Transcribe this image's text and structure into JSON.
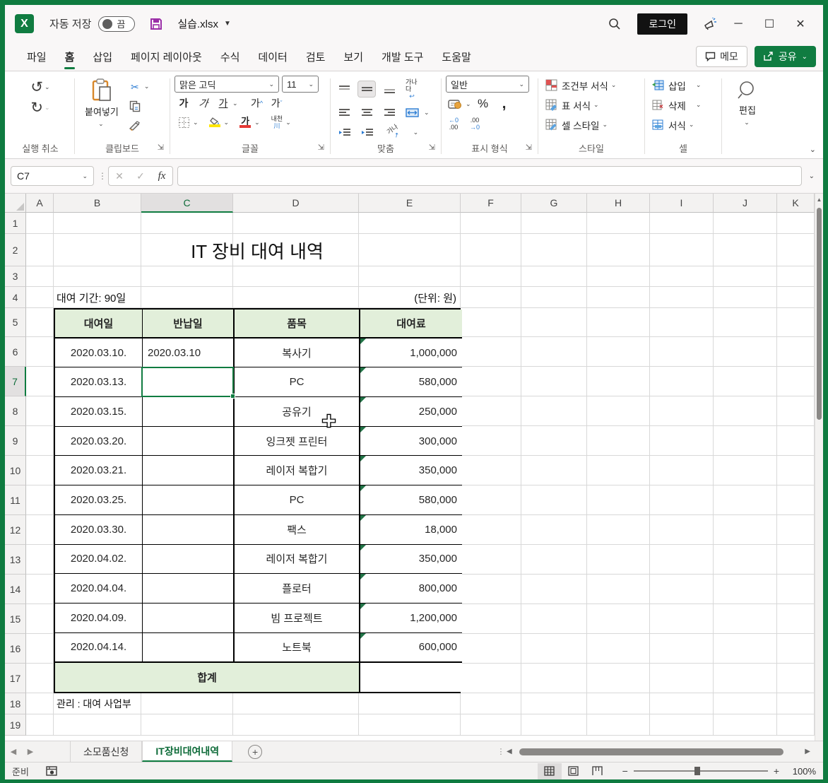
{
  "titlebar": {
    "autosave_label": "자동 저장",
    "autosave_state": "끔",
    "filename": "실습.xlsx",
    "login_label": "로그인"
  },
  "tabs": [
    "파일",
    "홈",
    "삽입",
    "페이지 레이아웃",
    "수식",
    "데이터",
    "검토",
    "보기",
    "개발 도구",
    "도움말"
  ],
  "tab_actions": {
    "memo": "메모",
    "share": "공유"
  },
  "ribbon": {
    "undo": {
      "label": "실행 취소"
    },
    "clipboard": {
      "paste": "붙여넣기",
      "label": "클립보드"
    },
    "font": {
      "family": "맑은 고딕",
      "size": "11",
      "bold": "가",
      "italic": "가",
      "underline": "가",
      "grow": "가",
      "shrink": "가",
      "ruby": "내천",
      "ruby_sub": "川",
      "label": "글꼴"
    },
    "align": {
      "wrap": "가나다",
      "orient": "가나",
      "label": "맞춤"
    },
    "number": {
      "format": "일반",
      "percent": "%",
      "comma": ",",
      "dec1_top": "←0",
      "dec1_bot": ".00",
      "dec2_top": ".00",
      "dec2_bot": "→0",
      "label": "표시 형식"
    },
    "styles": {
      "conditional": "조건부 서식",
      "table": "표 서식",
      "cell": "셀 스타일",
      "label": "스타일"
    },
    "cells": {
      "insert": "삽입",
      "delete": "삭제",
      "format": "서식",
      "label": "셀"
    },
    "editing": {
      "label": "편집"
    }
  },
  "formula_bar": {
    "name_box": "C7",
    "fx": "fx",
    "formula": ""
  },
  "sheet": {
    "col_letters": [
      "A",
      "B",
      "C",
      "D",
      "E",
      "F",
      "G",
      "H",
      "I",
      "J",
      "K"
    ],
    "row_numbers": [
      "1",
      "2",
      "3",
      "4",
      "5",
      "6",
      "7",
      "8",
      "9",
      "10",
      "11",
      "12",
      "13",
      "14",
      "15",
      "16",
      "17",
      "18",
      "19"
    ],
    "active_col": "C",
    "active_row": "7",
    "title": "IT 장비 대여 내역",
    "period_label": "대여 기간: 90일",
    "unit_label": "(단위: 원)",
    "table": {
      "headers": [
        "대여일",
        "반납일",
        "품목",
        "대여료"
      ],
      "rows": [
        {
          "date": "2020.03.10.",
          "ret": "2020.03.10",
          "item": "복사기",
          "fee": "1,000,000"
        },
        {
          "date": "2020.03.13.",
          "ret": "",
          "item": "PC",
          "fee": "580,000"
        },
        {
          "date": "2020.03.15.",
          "ret": "",
          "item": "공유기",
          "fee": "250,000"
        },
        {
          "date": "2020.03.20.",
          "ret": "",
          "item": "잉크젯 프린터",
          "fee": "300,000"
        },
        {
          "date": "2020.03.21.",
          "ret": "",
          "item": "레이저 복합기",
          "fee": "350,000"
        },
        {
          "date": "2020.03.25.",
          "ret": "",
          "item": "PC",
          "fee": "580,000"
        },
        {
          "date": "2020.03.30.",
          "ret": "",
          "item": "팩스",
          "fee": "18,000"
        },
        {
          "date": "2020.04.02.",
          "ret": "",
          "item": "레이저 복합기",
          "fee": "350,000"
        },
        {
          "date": "2020.04.04.",
          "ret": "",
          "item": "플로터",
          "fee": "800,000"
        },
        {
          "date": "2020.04.09.",
          "ret": "",
          "item": "빔 프로젝트",
          "fee": "1,200,000"
        },
        {
          "date": "2020.04.14.",
          "ret": "",
          "item": "노트북",
          "fee": "600,000"
        }
      ],
      "total_label": "합계",
      "total_value": ""
    },
    "footer_note": "관리 : 대여 사업부"
  },
  "sheet_tabs": [
    {
      "label": "소모품신청",
      "active": false
    },
    {
      "label": "IT장비대여내역",
      "active": true
    }
  ],
  "status_bar": {
    "ready": "준비",
    "zoom": "100%"
  },
  "colors": {
    "accent": "#107C41",
    "header_fill": "#E2EFDA",
    "error_triangle": "#217346",
    "save_icon": "#9B2FA8"
  }
}
